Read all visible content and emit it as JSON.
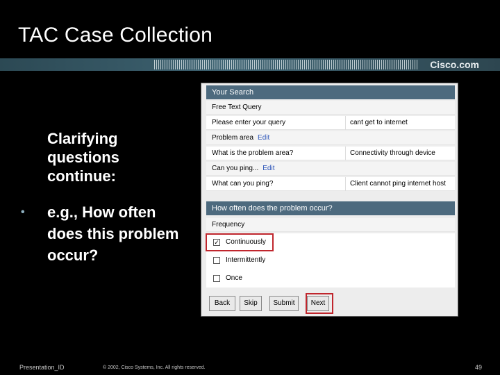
{
  "slide": {
    "title": "TAC Case Collection",
    "brand": "Cisco.com",
    "subtext": "Clarifying questions continue:",
    "bullet_marker": "•",
    "bullet": "e.g., How often does this problem occur?"
  },
  "panel": {
    "search_header": "Your Search",
    "rows": [
      {
        "label": "Free Text Query",
        "value": ""
      },
      {
        "label": "Please enter your query",
        "value": "cant get to internet"
      },
      {
        "label": "Problem area",
        "link": "Edit",
        "value": ""
      },
      {
        "label": "What is the problem area?",
        "value": "Connectivity through device"
      },
      {
        "label": "Can you ping...",
        "link": "Edit",
        "value": ""
      },
      {
        "label": "What can you ping?",
        "value": "Client cannot ping internet host"
      }
    ],
    "question_header": "How often does the problem occur?",
    "frequency_label": "Frequency",
    "options": [
      {
        "label": "Continuously",
        "checked": true,
        "mark": "✓"
      },
      {
        "label": "Intermittently",
        "checked": false,
        "mark": ""
      },
      {
        "label": "Once",
        "checked": false,
        "mark": ""
      }
    ],
    "buttons": {
      "back": "Back",
      "skip": "Skip",
      "submit": "Submit",
      "next": "Next"
    }
  },
  "footer": {
    "left": "Presentation_ID",
    "center": "© 2002, Cisco Systems, Inc. All rights reserved.",
    "page": "49"
  },
  "colors": {
    "background": "#000000",
    "panel_header": "#4d6a7e",
    "highlight": "#c0262d",
    "link": "#2a53b8"
  }
}
